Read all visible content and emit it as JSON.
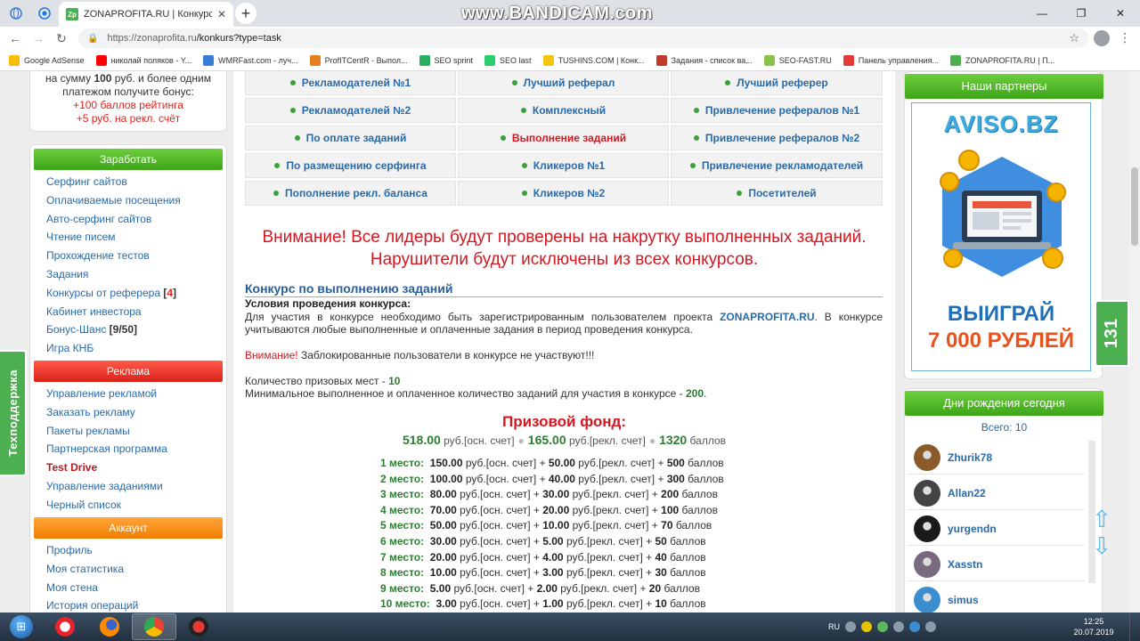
{
  "browser": {
    "tab_title": "ZONAPROFITA.RU | Конкурсы",
    "tab_favicon": "Zp",
    "watermark": "www.BANDICAM.com",
    "url_base": "https://zonaprofita.ru",
    "url_path": "/konkurs?type=task",
    "bookmarks": [
      {
        "label": "Google AdSense",
        "icon": "google-adsense-icon",
        "color": "#fbbc04"
      },
      {
        "label": "николай поляков - Y...",
        "icon": "youtube-icon",
        "color": "#ff0000"
      },
      {
        "label": "WMRFast.com - луч...",
        "icon": "wmrfast-icon",
        "color": "#3a7bd5"
      },
      {
        "label": "ProfITCentR - Выпол...",
        "icon": "profitcentr-icon",
        "color": "#e67e22"
      },
      {
        "label": "SEO sprint",
        "icon": "seosprint-icon",
        "color": "#27ae60"
      },
      {
        "label": "SEO last",
        "icon": "seolast-icon",
        "color": "#2ecc71"
      },
      {
        "label": "TUSHINS.COM | Конк...",
        "icon": "tushins-icon",
        "color": "#f1c40f"
      },
      {
        "label": "Задания - список ва...",
        "icon": "seoprofit-icon",
        "color": "#c0392b"
      },
      {
        "label": "SEO-FAST.RU",
        "icon": "seofast-icon",
        "color": "#8bc34a"
      },
      {
        "label": "Панель управления...",
        "icon": "yandex-icon",
        "color": "#e53935"
      },
      {
        "label": "ZONAPROFITA.RU | П...",
        "icon": "zonaprofita-icon",
        "color": "#4caf50"
      }
    ]
  },
  "left": {
    "bonus_line1_a": "на сумму ",
    "bonus_line1_b": "100",
    "bonus_line1_c": " руб. и более одним",
    "bonus_line2": "платежом получите бонус:",
    "bonus_line3": "+100 баллов рейтинга",
    "bonus_line4": "+5 руб. на рекл. счёт",
    "sections": {
      "earn": "Заработать",
      "ads": "Реклама",
      "account": "Аккаунт"
    },
    "earn_items": [
      "Серфинг сайтов",
      "Оплачиваемые посещения",
      "Авто-серфинг сайтов",
      "Чтение писем",
      "Прохождение тестов",
      "Задания"
    ],
    "referral_contests": "Конкурсы от реферера ",
    "referral_badge": "4",
    "investor": "Кабинет инвестора",
    "bonus_chance": "Бонус-Шанс ",
    "bonus_chance_badge": "9/50",
    "knb": "Игра КНБ",
    "ads_items": [
      "Управление рекламой",
      "Заказать рекламу",
      "Пакеты рекламы",
      "Партнерская программа"
    ],
    "test_drive": "Test Drive",
    "ads_items2": [
      "Управление заданиями",
      "Черный список"
    ],
    "account_items": [
      "Профиль",
      "Моя статистика",
      "Моя стена",
      "История операций"
    ],
    "support_tab": "Техподдержка"
  },
  "contests": {
    "grid": [
      [
        "Рекламодателей №1",
        "Лучший реферал",
        "Лучший реферер"
      ],
      [
        "Рекламодателей №2",
        "Комплексный",
        "Привлечение рефералов №1"
      ],
      [
        "По оплате заданий",
        "Выполнение заданий",
        "Привлечение рефералов №2"
      ],
      [
        "По размещению серфинга",
        "Кликеров №1",
        "Привлечение рекламодателей"
      ],
      [
        "Пополнение рекл. баланса",
        "Кликеров №2",
        "Посетителей"
      ]
    ],
    "warning_line1": "Внимание! Все лидеры будут проверены на накрутку выполненных заданий.",
    "warning_line2": "Нарушители будут исключены из всех конкурсов.",
    "title": "Конкурс по выполнению заданий",
    "cond_title": "Условия проведения конкурса:",
    "cond_text_a": "Для участия в конкурсе необходимо быть зарегистрированным пользователем проекта ",
    "cond_text_site": "ZONAPROFITA.RU",
    "cond_text_b": ". В конкурсе учитываются любые выполненные и оплаченные задания в период проведения конкурса.",
    "attn_word": "Внимание!",
    "attn_text": " Заблокированные пользователи в конкурсе не участвуют!!!",
    "places_label": "Количество призовых мест - ",
    "places_value": "10",
    "min_label": "Минимальное выполненное и оплаченное количество заданий для участия в конкурсе - ",
    "min_value": "200",
    "min_suffix": ".",
    "prize_title": "Призовой фонд:",
    "fund_main": "518.00",
    "fund_main_unit": " руб.[осн. счет]",
    "fund_ads": "165.00",
    "fund_ads_unit": " руб.[рекл. счет]",
    "fund_points": "1320",
    "fund_points_unit": " баллов",
    "prizes": [
      {
        "place": "1 место:",
        "main": "150.00",
        "ads": "50.00",
        "points": "500"
      },
      {
        "place": "2 место:",
        "main": "100.00",
        "ads": "40.00",
        "points": "300"
      },
      {
        "place": "3 место:",
        "main": "80.00",
        "ads": "30.00",
        "points": "200"
      },
      {
        "place": "4 место:",
        "main": "70.00",
        "ads": "20.00",
        "points": "100"
      },
      {
        "place": "5 место:",
        "main": "50.00",
        "ads": "10.00",
        "points": "70"
      },
      {
        "place": "6 место:",
        "main": "30.00",
        "ads": "5.00",
        "points": "50"
      },
      {
        "place": "7 место:",
        "main": "20.00",
        "ads": "4.00",
        "points": "40"
      },
      {
        "place": "8 место:",
        "main": "10.00",
        "ads": "3.00",
        "points": "30"
      },
      {
        "place": "9 место:",
        "main": "5.00",
        "ads": "2.00",
        "points": "20"
      },
      {
        "place": "10 место:",
        "main": "3.00",
        "ads": "1.00",
        "points": "10"
      }
    ],
    "unit_main": " руб.[осн. счет] + ",
    "unit_ads": " руб.[рекл. счет] + ",
    "unit_points": " баллов"
  },
  "right": {
    "partners_title": "Наши партнеры",
    "banner_brand": "AVISO.BZ",
    "banner_win": "ВЫИГРАЙ",
    "banner_amount": "7 000 РУБЛЕЙ",
    "birthdays_title": "Дни рождения сегодня",
    "birthdays_total": "Всего: 10",
    "users": [
      {
        "name": "Zhurik78",
        "color": "#8a5a2b"
      },
      {
        "name": "Allan22",
        "color": "#444444"
      },
      {
        "name": "yurgendn",
        "color": "#1a1a1a"
      },
      {
        "name": "Xasstn",
        "color": "#7a6a80"
      },
      {
        "name": "simus",
        "color": "#3b8fd0"
      }
    ],
    "online_count": "131"
  },
  "taskbar": {
    "lang": "RU",
    "time": "12:25",
    "date": "20.07.2019"
  }
}
